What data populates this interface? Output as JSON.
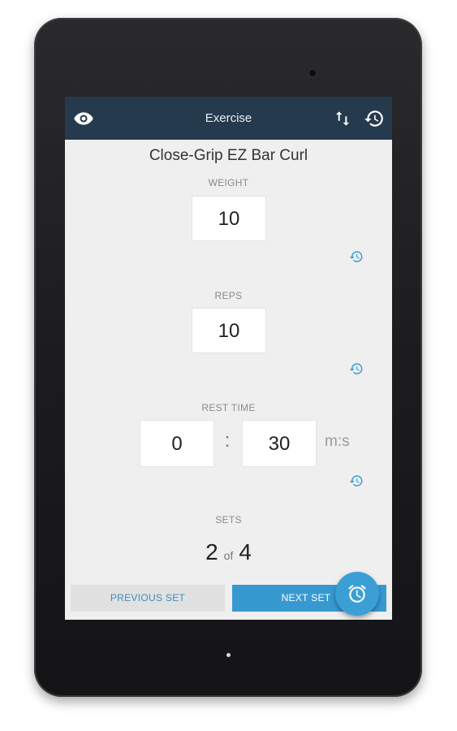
{
  "colors": {
    "appbar": "#263a4d",
    "accent": "#369ad1",
    "screen_bg": "#efefef"
  },
  "appbar": {
    "title": "Exercise",
    "icons": [
      "eye-icon",
      "swap-vertical-icon",
      "history-icon"
    ]
  },
  "exercise_name": "Close-Grip EZ Bar Curl",
  "weight": {
    "label": "WEIGHT",
    "value": "10"
  },
  "reps": {
    "label": "REPS",
    "value": "10"
  },
  "rest_time": {
    "label": "REST TIME",
    "minutes": "0",
    "separator": ":",
    "seconds": "30",
    "unit": "m:s"
  },
  "sets": {
    "label": "SETS",
    "current": "2",
    "of_text": "of",
    "total": "4"
  },
  "buttons": {
    "previous": "PREVIOUS SET",
    "next": "NEXT SET"
  },
  "fab_icon": "alarm-clock-icon"
}
